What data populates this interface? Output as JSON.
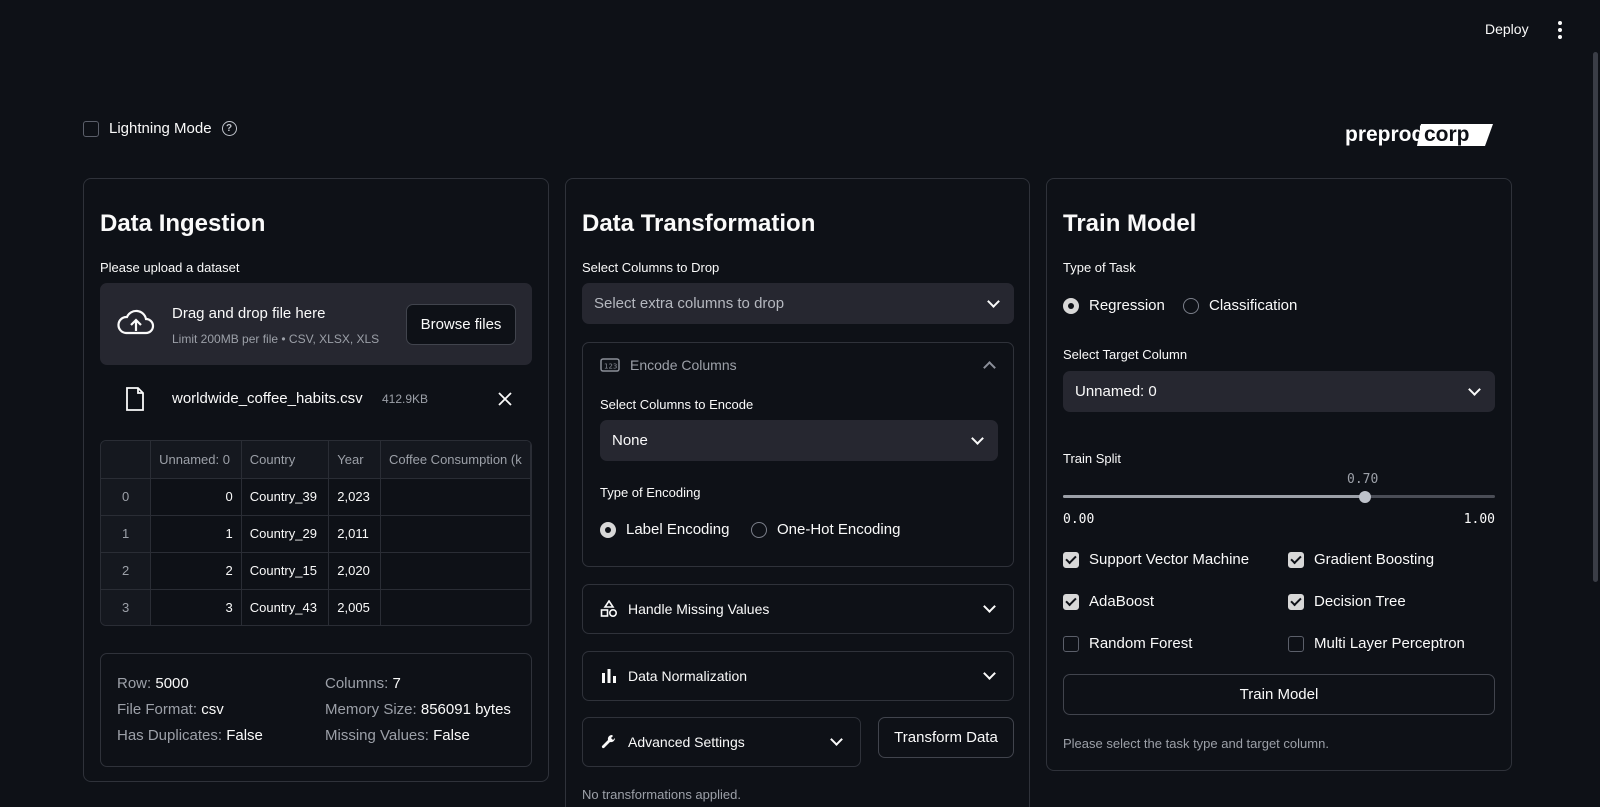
{
  "topbar": {
    "deploy_label": "Deploy",
    "menu_icon": "kebab-menu-icon"
  },
  "lightning": {
    "label": "Lightning Mode",
    "checked": false
  },
  "logo": {
    "text_a": "preprod",
    "text_b": "corp"
  },
  "ingestion": {
    "title": "Data Ingestion",
    "upload_label": "Please upload a dataset",
    "drop_text": "Drag and drop file here",
    "limit_text": "Limit 200MB per file • CSV, XLSX, XLS",
    "browse_label": "Browse files",
    "file_name": "worldwide_coffee_habits.csv",
    "file_size": "412.9KB",
    "table": {
      "headers": [
        "Unnamed: 0",
        "Country",
        "Year",
        "Coffee Consumption (k"
      ],
      "rows": [
        [
          "0",
          "0",
          "Country_39",
          "2,023",
          ""
        ],
        [
          "1",
          "1",
          "Country_29",
          "2,011",
          ""
        ],
        [
          "2",
          "2",
          "Country_15",
          "2,020",
          ""
        ],
        [
          "3",
          "3",
          "Country_43",
          "2,005",
          ""
        ]
      ]
    },
    "stats": {
      "row_k": "Row:",
      "row_v": "5000",
      "columns_k": "Columns:",
      "columns_v": "7",
      "format_k": "File Format:",
      "format_v": "csv",
      "memory_k": "Memory Size:",
      "memory_v": "856091 bytes",
      "dup_k": "Has Duplicates:",
      "dup_v": "False",
      "missing_k": "Missing Values:",
      "missing_v": "False"
    }
  },
  "transform": {
    "title": "Data Transformation",
    "drop_label": "Select Columns to Drop",
    "drop_placeholder": "Select extra columns to drop",
    "encode": {
      "title": "Encode Columns",
      "select_label": "Select Columns to Encode",
      "select_value": "None",
      "type_label": "Type of Encoding",
      "opt1": "Label Encoding",
      "opt2": "One-Hot Encoding"
    },
    "missing_title": "Handle Missing Values",
    "normalization_title": "Data Normalization",
    "advanced_title": "Advanced Settings",
    "transform_button": "Transform Data",
    "status": "No transformations applied."
  },
  "train": {
    "title": "Train Model",
    "task_label": "Type of Task",
    "task_opt1": "Regression",
    "task_opt2": "Classification",
    "target_label": "Select Target Column",
    "target_value": "Unnamed: 0",
    "split_label": "Train Split",
    "split_value": "0.70",
    "split_fraction": 0.7,
    "split_min": "0.00",
    "split_max": "1.00",
    "models": [
      {
        "label": "Support Vector Machine",
        "checked": true
      },
      {
        "label": "Gradient Boosting",
        "checked": true
      },
      {
        "label": "AdaBoost",
        "checked": true
      },
      {
        "label": "Decision Tree",
        "checked": true
      },
      {
        "label": "Random Forest",
        "checked": false
      },
      {
        "label": "Multi Layer Perceptron",
        "checked": false
      }
    ],
    "train_button": "Train Model",
    "hint": "Please select the task type and target column."
  }
}
